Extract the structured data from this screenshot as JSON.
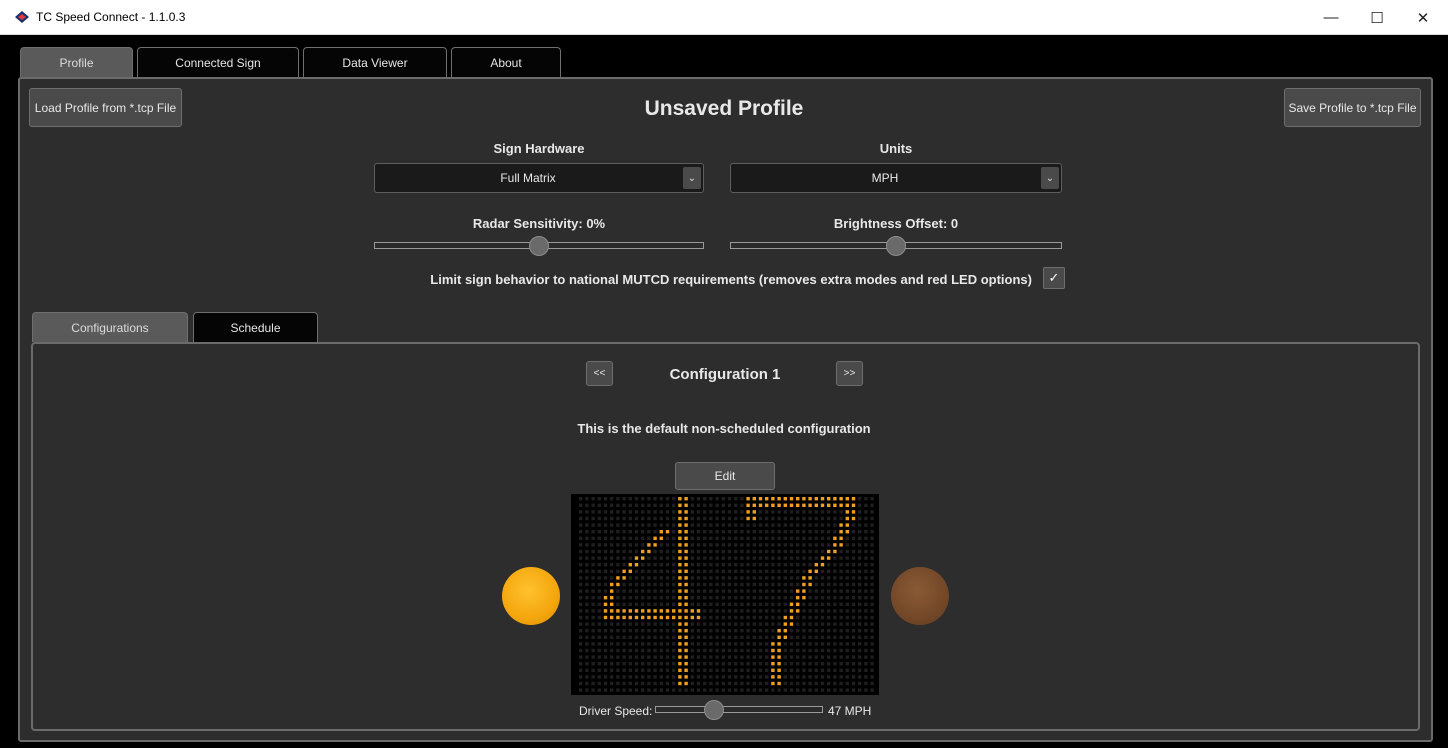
{
  "window": {
    "title": "TC Speed Connect - 1.1.0.3"
  },
  "tabs": [
    {
      "label": "Profile",
      "active": true
    },
    {
      "label": "Connected Sign",
      "active": false
    },
    {
      "label": "Data Viewer",
      "active": false
    },
    {
      "label": "About",
      "active": false
    }
  ],
  "profile": {
    "title": "Unsaved Profile",
    "load_button": "Load Profile from *.tcp File",
    "save_button": "Save Profile to *.tcp File",
    "sign_hardware": {
      "label": "Sign Hardware",
      "value": "Full Matrix"
    },
    "units": {
      "label": "Units",
      "value": "MPH"
    },
    "radar_sensitivity": {
      "label": "Radar Sensitivity: 0%",
      "value": 0
    },
    "brightness_offset": {
      "label": "Brightness Offset: 0",
      "value": 0
    },
    "mutcd": {
      "label": "Limit sign behavior to national MUTCD requirements (removes extra modes and red LED options)",
      "checked": true,
      "check_glyph": "✓"
    }
  },
  "subtabs": [
    {
      "label": "Configurations",
      "active": true
    },
    {
      "label": "Schedule",
      "active": false
    }
  ],
  "configuration": {
    "prev_label": "<<",
    "next_label": ">>",
    "title": "Configuration 1",
    "description": "This is the default non-scheduled configuration",
    "edit_label": "Edit",
    "display_digits": "47",
    "left_lamp_color": "#f4a60d",
    "right_lamp_color": "#734828",
    "led_color": "#f0a020"
  },
  "driver_speed": {
    "label": "Driver Speed:",
    "value_label": "47 MPH",
    "value": 47
  },
  "icons": {
    "minimize": "—",
    "maximize": "☐",
    "close": "✕"
  }
}
